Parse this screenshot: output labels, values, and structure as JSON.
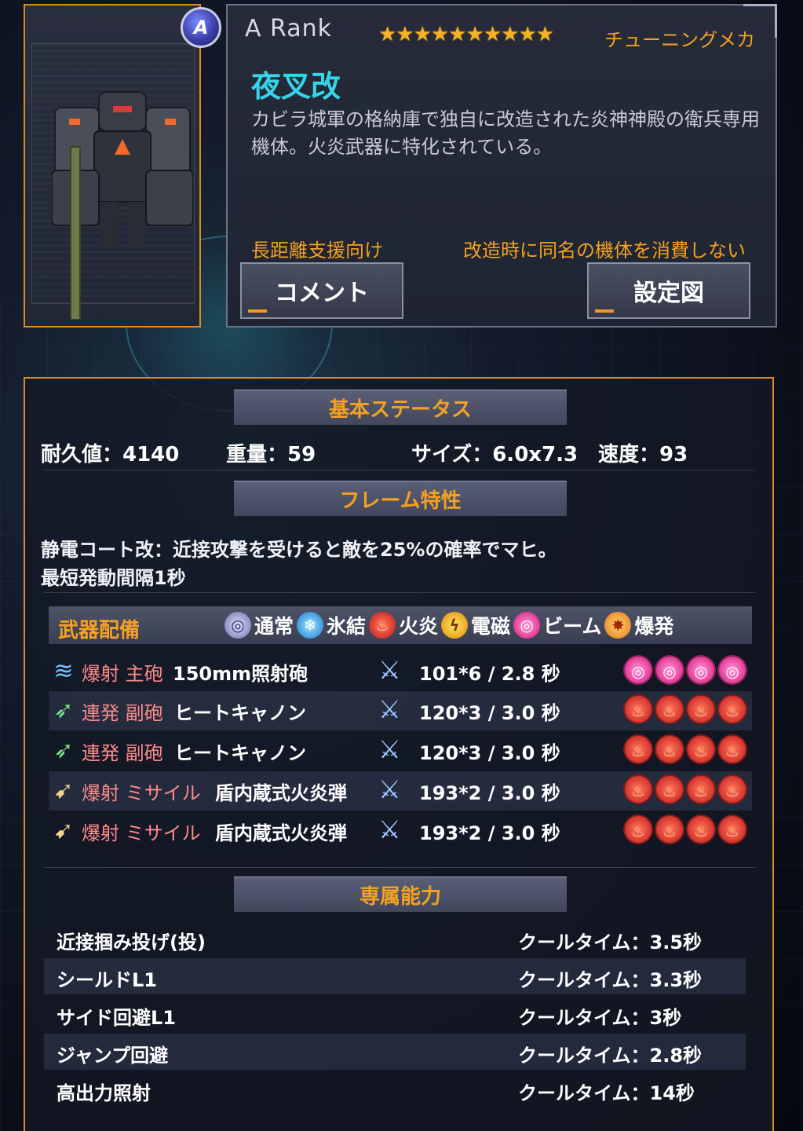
{
  "card": {
    "rank_badge": "A",
    "rank_title": "A  Rank",
    "stars": "★★★★★★★★★★",
    "type_label": "チューニングメカ",
    "name": "夜叉改",
    "description": "カビラ城軍の格納庫で独自に改造された炎神神殿の衛兵専用機体。火炎武器に特化されている。",
    "tag_left": "長距離支援向け",
    "tag_right": "改造時に同名の機体を消費しない",
    "comment_button": "コメント",
    "design_button": "設定図"
  },
  "basic": {
    "heading": "基本ステータス",
    "durability": "耐久値：4140",
    "weight": "重量：59",
    "size": "サイズ：6.0x7.3",
    "speed": "速度：93"
  },
  "frame": {
    "heading": "フレーム特性",
    "line1": "静電コート改：近接攻撃を受けると敵を25%の確率でマヒ。",
    "line2": "最短発動間隔1秒"
  },
  "weapons": {
    "heading": "武器配備",
    "legend": [
      "通常",
      "氷結",
      "火炎",
      "電磁",
      "ビーム",
      "爆発"
    ],
    "rows": [
      {
        "category": "爆射 主砲",
        "name": "150mm照射砲",
        "damage": "101*6 / 2.8 秒",
        "slots": "beam"
      },
      {
        "category": "連発 副砲",
        "name": "ヒートキャノン",
        "damage": "120*3 / 3.0 秒",
        "slots": "fire"
      },
      {
        "category": "連発 副砲",
        "name": "ヒートキャノン",
        "damage": "120*3 / 3.0 秒",
        "slots": "fire"
      },
      {
        "category": "爆射 ミサイル",
        "name": "盾内蔵式火炎弾",
        "damage": "193*2 / 3.0 秒",
        "slots": "fire"
      },
      {
        "category": "爆射 ミサイル",
        "name": "盾内蔵式火炎弾",
        "damage": "193*2 / 3.0 秒",
        "slots": "fire"
      }
    ]
  },
  "abilities": {
    "heading": "専属能力",
    "rows": [
      {
        "name": "近接掴み投げ(投)",
        "cooldown": "クールタイム：3.5秒"
      },
      {
        "name": "シールドL1",
        "cooldown": "クールタイム：3.3秒"
      },
      {
        "name": "サイド回避L1",
        "cooldown": "クールタイム：3秒"
      },
      {
        "name": "ジャンプ回避",
        "cooldown": "クールタイム：2.8秒"
      },
      {
        "name": "高出力照射",
        "cooldown": "クールタイム：14秒"
      }
    ]
  }
}
